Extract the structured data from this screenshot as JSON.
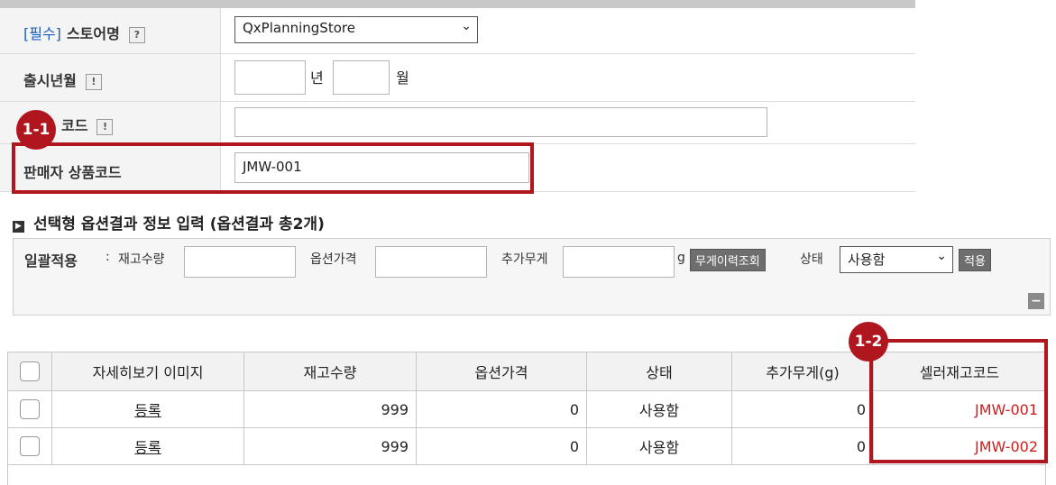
{
  "form": {
    "store_required": "[필수]",
    "store_label": "스토어명",
    "store_help": "?",
    "store_value": "QxPlanningStore",
    "release_label": "출시년월",
    "release_help": "!",
    "year_unit": "년",
    "month_unit": "월",
    "code_label": "코드",
    "code_help": "!",
    "seller_code_label": "판매자 상품코드",
    "seller_code_value": "JMW-001"
  },
  "badges": {
    "b1": "1-1",
    "b2": "1-2"
  },
  "section": {
    "title": "선택형 옵션결과 정보 입력 (옵션결과 총2개)"
  },
  "bulk": {
    "label": "일괄적용",
    "colon": ":",
    "stock_label": "재고수량",
    "price_label": "옵션가격",
    "weight_label": "추가무게",
    "weight_unit": "g",
    "weight_history_button": "무게이력조회",
    "status_label": "상태",
    "status_value": "사용함",
    "apply_button": "적용",
    "collapse": "−"
  },
  "table": {
    "headers": [
      "",
      "자세히보기 이미지",
      "재고수량",
      "옵션가격",
      "상태",
      "추가무게(g)",
      "셀러재고코드"
    ],
    "rows": [
      {
        "image": "등록",
        "stock": "999",
        "price": "0",
        "status": "사용함",
        "weight": "0",
        "code": "JMW-001"
      },
      {
        "image": "등록",
        "stock": "999",
        "price": "0",
        "status": "사용함",
        "weight": "0",
        "code": "JMW-002"
      }
    ]
  },
  "colors": {
    "highlight": "#b0161d",
    "code_text": "#cc1f1f",
    "required": "#1b5fbf"
  }
}
